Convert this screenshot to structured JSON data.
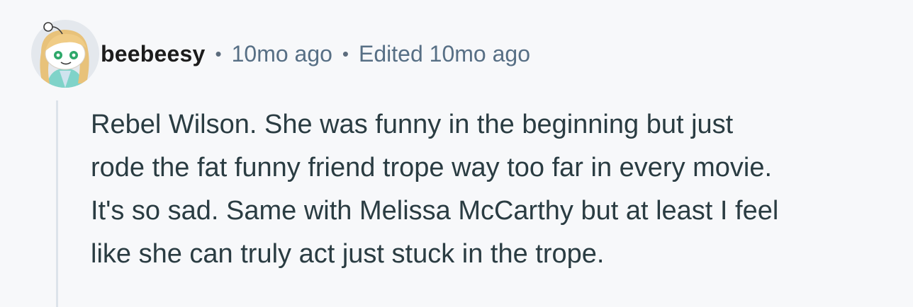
{
  "comment": {
    "author": "beebeesy",
    "separator": "•",
    "posted_ago": "10mo ago",
    "edited_label": "Edited 10mo ago",
    "body_lines": [
      "Rebel Wilson. She was funny in the beginning but just",
      "rode the fat funny friend trope way too far in every movie.",
      "It's so sad. Same with Melissa McCarthy but at least I feel",
      "like she can truly act just stuck in the trope."
    ]
  },
  "colors": {
    "background": "#f7f8fa",
    "meta_text": "#576f85",
    "body_text": "#2a3c42",
    "thread_line": "#dde3ea"
  },
  "icons": {
    "avatar": "snoo-avatar-icon"
  }
}
